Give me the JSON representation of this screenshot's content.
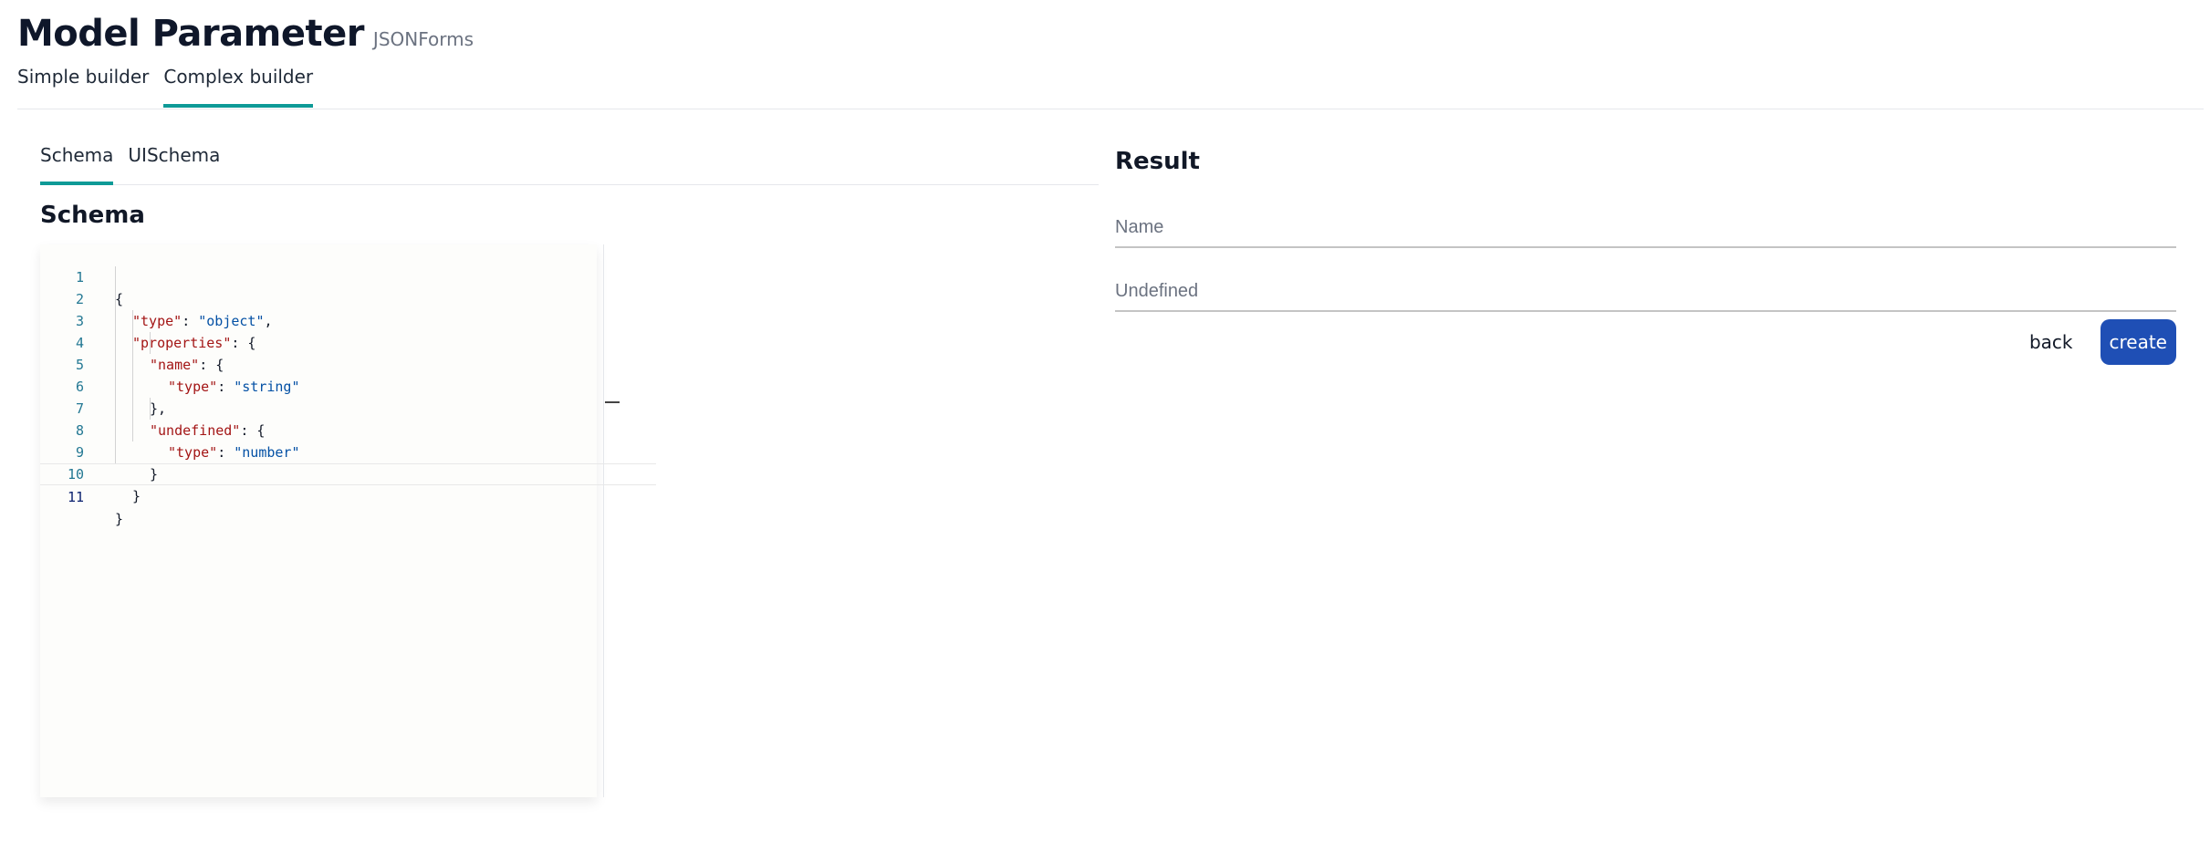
{
  "header": {
    "title": "Model Parameter",
    "subtitle": "JSONForms"
  },
  "main_tabs": [
    {
      "label": "Simple builder",
      "active": false
    },
    {
      "label": "Complex builder",
      "active": true
    }
  ],
  "left": {
    "sub_tabs": [
      {
        "label": "Schema",
        "active": true
      },
      {
        "label": "UISchema",
        "active": false
      }
    ],
    "section_title": "Schema",
    "code_lines": [
      {
        "num": "1",
        "text": "{"
      },
      {
        "num": "2",
        "text": "\"type\": \"object\","
      },
      {
        "num": "3",
        "text": "\"properties\": {"
      },
      {
        "num": "4",
        "text": "\"name\": {"
      },
      {
        "num": "5",
        "text": "\"type\": \"string\""
      },
      {
        "num": "6",
        "text": "},"
      },
      {
        "num": "7",
        "text": "\"undefined\": {"
      },
      {
        "num": "8",
        "text": "\"type\": \"number\""
      },
      {
        "num": "9",
        "text": "}"
      },
      {
        "num": "10",
        "text": "}"
      },
      {
        "num": "11",
        "text": "}"
      }
    ]
  },
  "right": {
    "title": "Result",
    "fields": [
      {
        "placeholder": "Name",
        "value": ""
      },
      {
        "placeholder": "Undefined",
        "value": ""
      }
    ],
    "back_label": "back",
    "create_label": "create"
  },
  "colors": {
    "accent": "#0e9a97",
    "primary_button": "#1f4fb5",
    "json_key": "#a31515",
    "json_string": "#0451a5",
    "line_number": "#237893"
  }
}
